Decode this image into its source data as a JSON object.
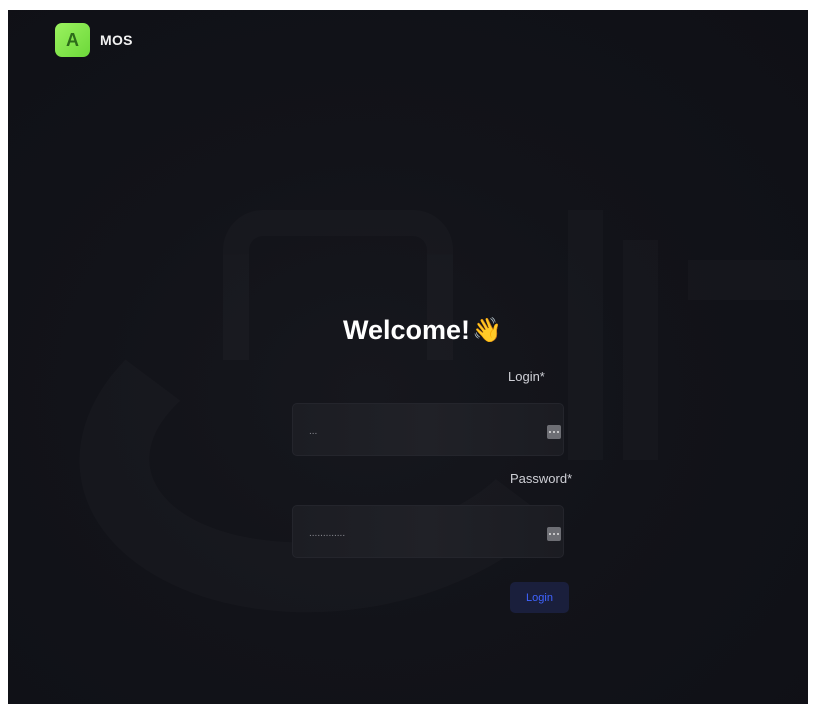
{
  "brand": {
    "logo_letter": "A",
    "name": "MOS",
    "accent": "#7be349"
  },
  "heading": {
    "title": "Welcome!",
    "emoji": "👋"
  },
  "form": {
    "login": {
      "label": "Login*",
      "value": "..."
    },
    "password": {
      "label": "Password*",
      "value": "............."
    },
    "submit_label": "Login"
  },
  "colors": {
    "background": "#121319",
    "field": "#1e1f25",
    "button_bg": "#1a1f3c",
    "button_text": "#3f63ff"
  }
}
